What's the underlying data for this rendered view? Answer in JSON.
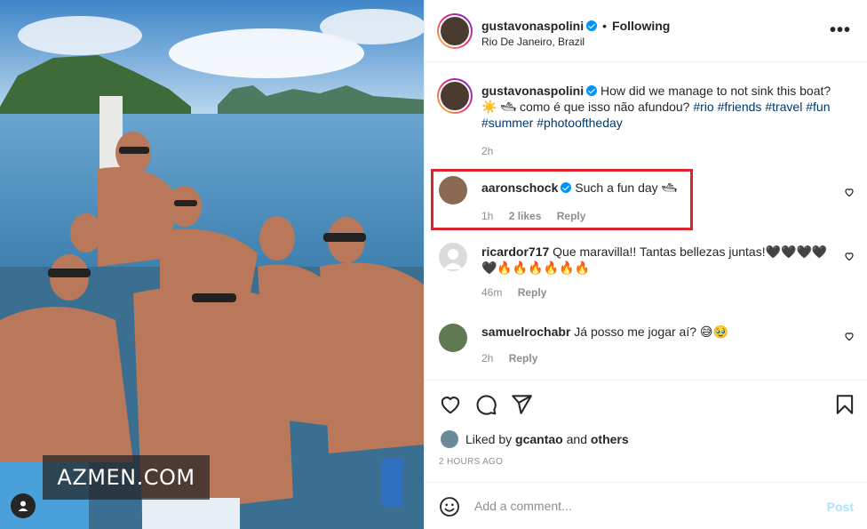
{
  "photo": {
    "watermark": "AZMEN.COM",
    "tag_icon": "user-tag-icon"
  },
  "header": {
    "username": "gustavonaspolini",
    "separator": "•",
    "follow_status": "Following",
    "location": "Rio De Janeiro, Brazil",
    "more_icon": "more-options-icon",
    "more_glyph": "•••"
  },
  "caption": {
    "username": "gustavonaspolini",
    "text_before": "How did we manage to not sink this boat? ☀️ 🛥 como é que isso não afundou?",
    "hashtags": [
      "#rio",
      "#friends",
      "#travel",
      "#fun",
      "#summer",
      "#photooftheday"
    ],
    "time": "2h"
  },
  "comments": [
    {
      "username": "aaronschock",
      "verified": true,
      "text": "Such a fun day 🛥",
      "time": "1h",
      "likes": "2 likes",
      "reply": "Reply"
    },
    {
      "username": "ricardor717",
      "verified": false,
      "text": "Que maravilla!! Tantas bellezas juntas!🖤🖤🖤🖤🖤🔥🔥🔥🔥🔥🔥",
      "time": "46m",
      "reply": "Reply"
    },
    {
      "username": "samuelrochabr",
      "verified": false,
      "text": "Já posso me jogar aí? 😅🥹",
      "time": "2h",
      "reply": "Reply"
    }
  ],
  "actions": {
    "icons": [
      "heart-icon",
      "comment-icon",
      "share-icon",
      "bookmark-icon"
    ]
  },
  "likes": {
    "prefix": "Liked by",
    "user": "gcantao",
    "joiner": "and",
    "others": "others"
  },
  "posted_time": "2 HOURS AGO",
  "add_comment": {
    "placeholder": "Add a comment...",
    "post_label": "Post"
  },
  "colors": {
    "link": "#00376b",
    "verified": "#0095f6",
    "highlight": "#d9262c",
    "post_disabled": "#b2dffc"
  }
}
